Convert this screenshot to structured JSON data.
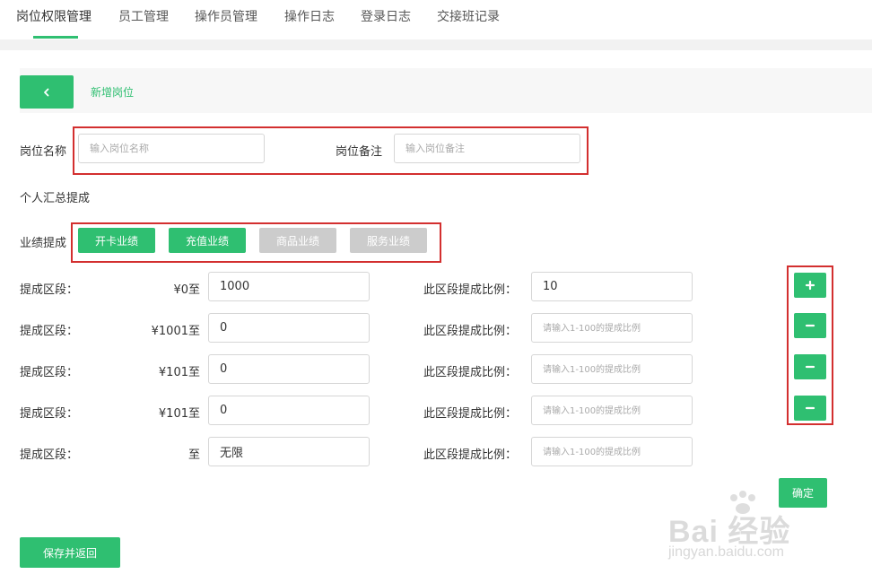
{
  "tabs": [
    {
      "label": "岗位权限管理",
      "active": true
    },
    {
      "label": "员工管理",
      "active": false
    },
    {
      "label": "操作员管理",
      "active": false
    },
    {
      "label": "操作日志",
      "active": false
    },
    {
      "label": "登录日志",
      "active": false
    },
    {
      "label": "交接班记录",
      "active": false
    }
  ],
  "header": {
    "back_icon": "chevron-left-icon",
    "title": "新增岗位"
  },
  "form": {
    "name_label": "岗位名称",
    "name_placeholder": "输入岗位名称",
    "name_value": "",
    "remark_label": "岗位备注",
    "remark_placeholder": "输入岗位备注",
    "remark_value": ""
  },
  "summary_label": "个人汇总提成",
  "performance": {
    "label": "业绩提成",
    "buttons": [
      {
        "label": "开卡业绩",
        "selected": true
      },
      {
        "label": "充值业绩",
        "selected": true
      },
      {
        "label": "商品业绩",
        "selected": false
      },
      {
        "label": "服务业绩",
        "selected": false
      }
    ]
  },
  "ranges": [
    {
      "label": "提成区段：",
      "from": "¥0至",
      "to_value": "1000",
      "ratio_label": "此区段提成比例：",
      "ratio_value": "10",
      "ratio_placeholder": "请输入1-100的提成比例",
      "action": "plus-icon"
    },
    {
      "label": "提成区段：",
      "from": "¥1001至",
      "to_value": "0",
      "ratio_label": "此区段提成比例：",
      "ratio_value": "",
      "ratio_placeholder": "请输入1-100的提成比例",
      "action": "minus-icon"
    },
    {
      "label": "提成区段：",
      "from": "¥101至",
      "to_value": "0",
      "ratio_label": "此区段提成比例：",
      "ratio_value": "",
      "ratio_placeholder": "请输入1-100的提成比例",
      "action": "minus-icon"
    },
    {
      "label": "提成区段：",
      "from": "¥101至",
      "to_value": "0",
      "ratio_label": "此区段提成比例：",
      "ratio_value": "",
      "ratio_placeholder": "请输入1-100的提成比例",
      "action": "minus-icon"
    },
    {
      "label": "提成区段：",
      "from": "至",
      "to_value": "无限",
      "ratio_label": "此区段提成比例：",
      "ratio_value": "",
      "ratio_placeholder": "请输入1-100的提成比例",
      "action": ""
    }
  ],
  "confirm_label": "确定",
  "save_label": "保存并返回",
  "watermark": {
    "text": "Bai 经验",
    "url": "jingyan.baidu.com"
  },
  "colors": {
    "accent": "#2fbf71",
    "disabled": "#cccccc",
    "highlight_box": "#d32f2f"
  }
}
